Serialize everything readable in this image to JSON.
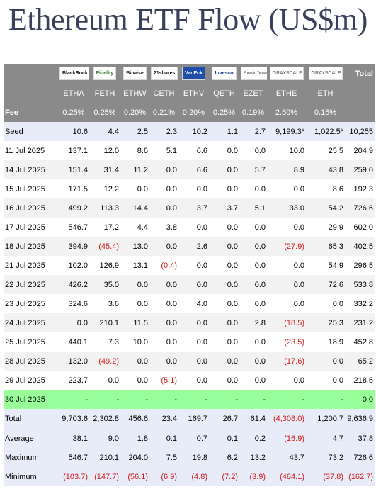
{
  "title": "Ethereum ETF Flow (US$m)",
  "issuers": [
    {
      "name": "BlackRock",
      "icon": "blackrock-logo"
    },
    {
      "name": "Fidelity",
      "icon": "fidelity-logo"
    },
    {
      "name": "Bitwise",
      "icon": "bitwise-logo"
    },
    {
      "name": "21shares",
      "icon": "21shares-logo"
    },
    {
      "name": "VanEck",
      "icon": "vaneck-logo"
    },
    {
      "name": "Invesco",
      "icon": "invesco-logo"
    },
    {
      "name": "Franklin Templeton",
      "icon": "franklin-templeton-logo"
    },
    {
      "name": "GRAYSCALE",
      "icon": "grayscale-logo"
    },
    {
      "name": "GRAYSCALE",
      "icon": "grayscale-logo"
    }
  ],
  "total_header": "Total",
  "tickers": [
    "ETHA",
    "FETH",
    "ETHW",
    "CETH",
    "ETHV",
    "QETH",
    "EZET",
    "ETHE",
    "ETH"
  ],
  "fee": {
    "label": "Fee",
    "values": [
      "0.25%",
      "0.25%",
      "0.20%",
      "0.21%",
      "0.20%",
      "0.25%",
      "0.19%",
      "2.50%",
      "0.15%"
    ]
  },
  "rows": [
    {
      "label": "Seed",
      "values": [
        "10.6",
        "4.4",
        "2.5",
        "2.3",
        "10.2",
        "1.1",
        "2.7",
        "9,199.3*",
        "1,022.5*"
      ],
      "total": "10,255"
    },
    {
      "label": "11 Jul 2025",
      "values": [
        "137.1",
        "12.0",
        "8.6",
        "5.1",
        "6.6",
        "0.0",
        "0.0",
        "10.0",
        "25.5"
      ],
      "total": "204.9"
    },
    {
      "label": "14 Jul 2025",
      "values": [
        "151.4",
        "31.4",
        "11.2",
        "0.0",
        "6.6",
        "0.0",
        "5.7",
        "8.9",
        "43.8"
      ],
      "total": "259.0"
    },
    {
      "label": "15 Jul 2025",
      "values": [
        "171.5",
        "12.2",
        "0.0",
        "0.0",
        "0.0",
        "0.0",
        "0.0",
        "0.0",
        "8.6"
      ],
      "total": "192.3"
    },
    {
      "label": "16 Jul 2025",
      "values": [
        "499.2",
        "113.3",
        "14.4",
        "0.0",
        "3.7",
        "3.7",
        "5.1",
        "33.0",
        "54.2"
      ],
      "total": "726.6"
    },
    {
      "label": "17 Jul 2025",
      "values": [
        "546.7",
        "17.2",
        "4.4",
        "3.8",
        "0.0",
        "0.0",
        "0.0",
        "0.0",
        "29.9"
      ],
      "total": "602.0"
    },
    {
      "label": "18 Jul 2025",
      "values": [
        "394.9",
        "(45.4)",
        "13.0",
        "0.0",
        "2.6",
        "0.0",
        "0.0",
        "(27.9)",
        "65.3"
      ],
      "total": "402.5"
    },
    {
      "label": "21 Jul 2025",
      "values": [
        "102.0",
        "126.9",
        "13.1",
        "(0.4)",
        "0.0",
        "0.0",
        "0.0",
        "0.0",
        "54.9"
      ],
      "total": "296.5"
    },
    {
      "label": "22 Jul 2025",
      "values": [
        "426.2",
        "35.0",
        "0.0",
        "0.0",
        "0.0",
        "0.0",
        "0.0",
        "0.0",
        "72.6"
      ],
      "total": "533.8"
    },
    {
      "label": "23 Jul 2025",
      "values": [
        "324.6",
        "3.6",
        "0.0",
        "0.0",
        "4.0",
        "0.0",
        "0.0",
        "0.0",
        "0.0"
      ],
      "total": "332.2"
    },
    {
      "label": "24 Jul 2025",
      "values": [
        "0.0",
        "210.1",
        "11.5",
        "0.0",
        "0.0",
        "0.0",
        "2.8",
        "(18.5)",
        "25.3"
      ],
      "total": "231.2"
    },
    {
      "label": "25 Jul 2025",
      "values": [
        "440.1",
        "7.3",
        "10.0",
        "0.0",
        "0.0",
        "0.0",
        "0.0",
        "(23.5)",
        "18.9"
      ],
      "total": "452.8"
    },
    {
      "label": "28 Jul 2025",
      "values": [
        "132.0",
        "(49.2)",
        "0.0",
        "0.0",
        "0.0",
        "0.0",
        "0.0",
        "(17.6)",
        "0.0"
      ],
      "total": "65.2"
    },
    {
      "label": "29 Jul 2025",
      "values": [
        "223.7",
        "0.0",
        "0.0",
        "(5.1)",
        "0.0",
        "0.0",
        "0.0",
        "0.0",
        "0.0"
      ],
      "total": "218.6"
    },
    {
      "label": "30 Jul 2025",
      "values": [
        "-",
        "-",
        "-",
        "-",
        "-",
        "-",
        "-",
        "-",
        "-"
      ],
      "total": "0.0",
      "highlight": true
    }
  ],
  "summary": [
    {
      "label": "Total",
      "values": [
        "9,703.6",
        "2,302.8",
        "456.6",
        "23.4",
        "169.7",
        "26.7",
        "61.4",
        "(4,308.0)",
        "1,200.7"
      ],
      "total": "9,636.9"
    },
    {
      "label": "Average",
      "values": [
        "38.1",
        "9.0",
        "1.8",
        "0.1",
        "0.7",
        "0.1",
        "0.2",
        "(16.9)",
        "4.7"
      ],
      "total": "37.8"
    },
    {
      "label": "Maximum",
      "values": [
        "546.7",
        "210.1",
        "204.0",
        "7.5",
        "19.8",
        "6.2",
        "13.2",
        "43.7",
        "73.2"
      ],
      "total": "726.6"
    },
    {
      "label": "Minimum",
      "values": [
        "(103.7)",
        "(147.7)",
        "(56.1)",
        "(6.9)",
        "(4.8)",
        "(7.2)",
        "(3.9)",
        "(484.1)",
        "(37.8)"
      ],
      "total": "(162.7)"
    }
  ],
  "colors": {
    "header_gray": "#8a8a8a",
    "row_alt": "#f2f2f2",
    "summary_blue": "#e8ecf8",
    "highlight_green": "#99ff99",
    "negative_red": "#d11a1a",
    "title": "#3a3f5c"
  }
}
